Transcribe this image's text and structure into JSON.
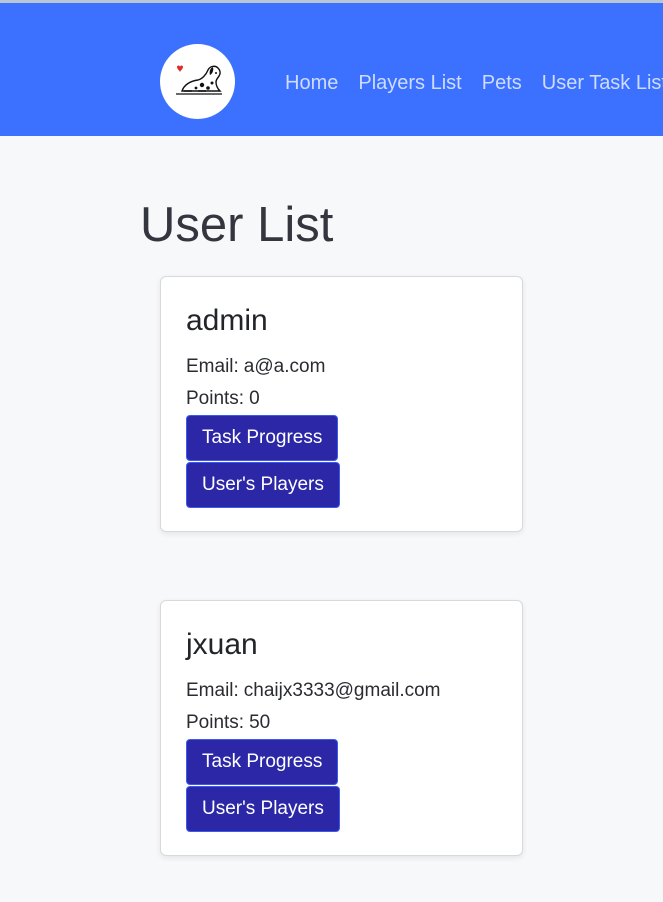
{
  "nav": {
    "logo_icon": "dalmatian-dog-logo",
    "links": [
      "Home",
      "Players List",
      "Pets",
      "User Task List"
    ]
  },
  "page": {
    "title": "User List"
  },
  "users": [
    {
      "name": "admin",
      "email_label": "Email:",
      "email": "a@a.com",
      "points_label": "Points:",
      "points": "0",
      "task_button": "Task Progress",
      "players_button": "User's Players"
    },
    {
      "name": "jxuan",
      "email_label": "Email:",
      "email": "chaijx3333@gmail.com",
      "points_label": "Points:",
      "points": "50",
      "task_button": "Task Progress",
      "players_button": "User's Players"
    }
  ],
  "colors": {
    "navbar": "#3b71fe",
    "nav_link": "#cfdcff",
    "button": "#2b27a6",
    "page_bg": "#f7f8fa"
  }
}
